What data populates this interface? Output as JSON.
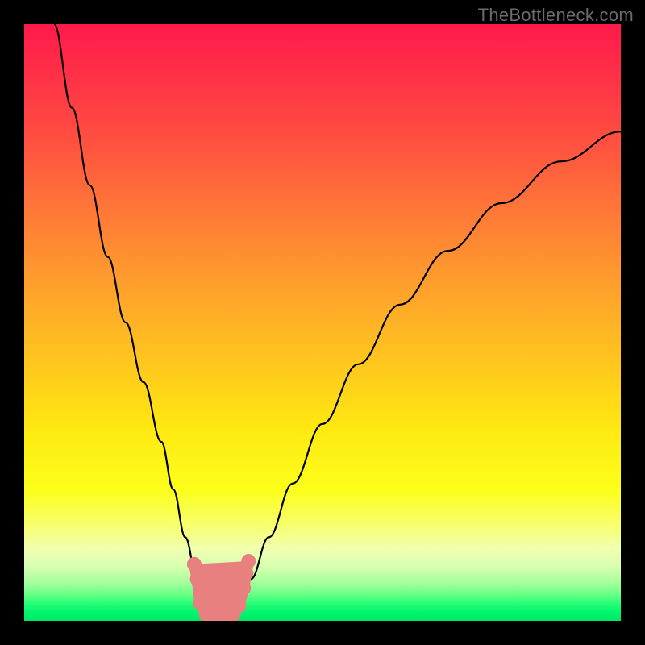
{
  "watermark": "TheBottleneck.com",
  "colors": {
    "frame": "#000000",
    "curve": "#000000",
    "marker": "#e98080",
    "gradient_top": "#ff1a4b",
    "gradient_mid": "#ffe912",
    "gradient_bottom": "#00e868"
  },
  "chart_data": {
    "type": "line",
    "title": "",
    "xlabel": "",
    "ylabel": "",
    "xlim": [
      0,
      100
    ],
    "ylim": [
      0,
      100
    ],
    "grid": false,
    "note": "No numeric axes or tick labels are rendered in the image; x/y are normalized 0-100 based on the plot box. y=0 is the bottom (green) edge, y=100 is the top (red) edge.",
    "series": [
      {
        "name": "left-descending-curve",
        "x": [
          5,
          8,
          11,
          14,
          17,
          20,
          23,
          25,
          27,
          29,
          30.5,
          31
        ],
        "y": [
          100,
          86,
          73,
          61,
          50,
          40,
          30,
          22,
          14,
          7,
          2,
          0
        ]
      },
      {
        "name": "right-ascending-curve",
        "x": [
          35,
          36,
          38,
          41,
          45,
          50,
          56,
          63,
          71,
          80,
          90,
          100
        ],
        "y": [
          0,
          2,
          7,
          14,
          23,
          33,
          43,
          53,
          62,
          70,
          77,
          82
        ]
      }
    ],
    "markers": {
      "name": "bottom-pink-cluster",
      "points": [
        {
          "x": 28.5,
          "y": 9.5
        },
        {
          "x": 29.0,
          "y": 7.0
        },
        {
          "x": 29.5,
          "y": 3.0
        },
        {
          "x": 30.5,
          "y": 1.0
        },
        {
          "x": 32.0,
          "y": 0.5
        },
        {
          "x": 33.5,
          "y": 0.5
        },
        {
          "x": 35.0,
          "y": 1.0
        },
        {
          "x": 36.0,
          "y": 2.5
        },
        {
          "x": 36.8,
          "y": 5.5
        },
        {
          "x": 37.2,
          "y": 8.0
        },
        {
          "x": 37.6,
          "y": 10.0
        }
      ]
    }
  }
}
